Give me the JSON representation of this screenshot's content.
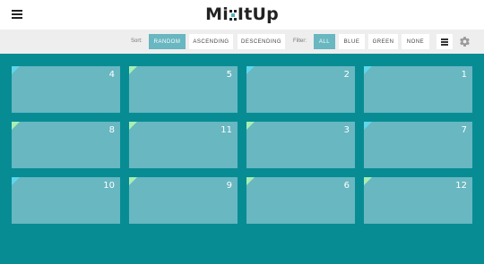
{
  "header": {
    "logo_text": "Mi",
    "logo_text_2": "ItUp",
    "menu_icon": "hamburger-icon"
  },
  "controls": {
    "sort_label": "Sort:",
    "sort_options": [
      "RANDOM",
      "ASCENDING",
      "DESCENDING"
    ],
    "sort_active": "RANDOM",
    "filter_label": "Filter:",
    "filter_options": [
      "ALL",
      "BLUE",
      "GREEN",
      "NONE"
    ],
    "filter_active": "ALL",
    "layout_icon": "list-icon",
    "settings_icon": "gear-icon"
  },
  "colors": {
    "accent": "#68b7c1",
    "stage": "#088c94",
    "blue_tag": "#5ed6ec",
    "green_tag": "#a8efb3"
  },
  "cards": [
    {
      "number": "4",
      "tag": "blue"
    },
    {
      "number": "5",
      "tag": "green"
    },
    {
      "number": "2",
      "tag": "blue"
    },
    {
      "number": "1",
      "tag": "blue"
    },
    {
      "number": "8",
      "tag": "green"
    },
    {
      "number": "11",
      "tag": "green"
    },
    {
      "number": "3",
      "tag": "green"
    },
    {
      "number": "7",
      "tag": "blue"
    },
    {
      "number": "10",
      "tag": "blue"
    },
    {
      "number": "9",
      "tag": "green"
    },
    {
      "number": "6",
      "tag": "green"
    },
    {
      "number": "12",
      "tag": "green"
    }
  ]
}
